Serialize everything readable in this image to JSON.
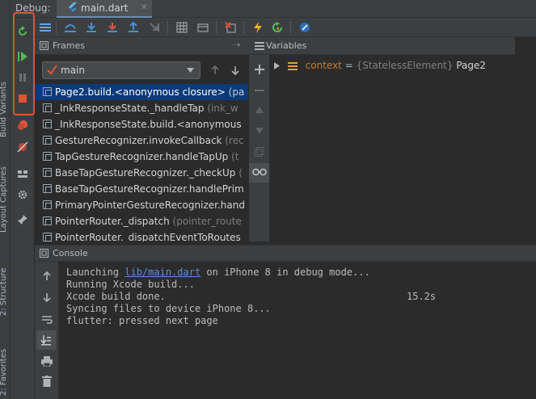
{
  "side_tabs": [
    "Build Variants",
    "Layout Captures",
    "2: Structure",
    "2: Favorites"
  ],
  "title": {
    "label": "Debug:",
    "tab": "main.dart"
  },
  "frames": {
    "header": "Frames",
    "thread": "main",
    "items": [
      {
        "fn": "Page2.build.<anonymous closure>",
        "loc": "(pa"
      },
      {
        "fn": "_InkResponseState._handleTap",
        "loc": "(ink_w"
      },
      {
        "fn": "_InkResponseState.build.<anonymous",
        "loc": ""
      },
      {
        "fn": "GestureRecognizer.invokeCallback",
        "loc": "(rec"
      },
      {
        "fn": "TapGestureRecognizer.handleTapUp",
        "loc": "(t"
      },
      {
        "fn": "BaseTapGestureRecognizer._checkUp",
        "loc": "("
      },
      {
        "fn": "BaseTapGestureRecognizer.handlePrim",
        "loc": ""
      },
      {
        "fn": "PrimaryPointerGestureRecognizer.hand",
        "loc": ""
      },
      {
        "fn": "PointerRouter._dispatch",
        "loc": "(pointer_route"
      },
      {
        "fn": "PointerRouter._dispatchEventToRoutes",
        "loc": ""
      }
    ]
  },
  "variables": {
    "header": "Variables",
    "items": [
      {
        "name": "context",
        "eq": " = ",
        "type": "{StatelessElement}",
        "value": "Page2"
      }
    ]
  },
  "console": {
    "header": "Console",
    "lines": [
      {
        "pre": "Launching ",
        "link": "lib/main.dart",
        "post": " on iPhone 8 in debug mode..."
      },
      {
        "pre": "Running Xcode build...",
        "link": "",
        "post": ""
      },
      {
        "pre": "Xcode build done.",
        "link": "",
        "post": ""
      },
      {
        "pre": "Syncing files to device iPhone 8...",
        "link": "",
        "post": ""
      },
      {
        "pre": "flutter: pressed next page",
        "link": "",
        "post": ""
      }
    ],
    "build_time": "15.2s"
  },
  "colors": {
    "accent": "#e05334",
    "selection": "#0d3a7a",
    "link": "#5b8fd9",
    "var_name": "#cc7832"
  }
}
